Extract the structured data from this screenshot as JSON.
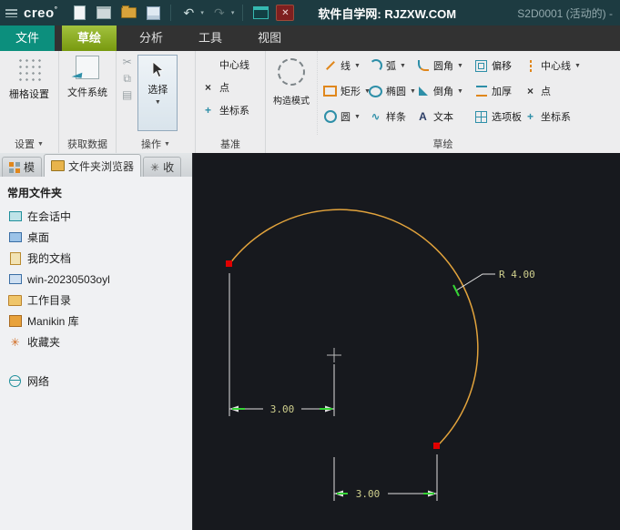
{
  "ui": {
    "dropdown": "▼",
    "small_dropdown": "▾",
    "icons": {
      "undo": "↶",
      "redo": "↷",
      "close": "✕",
      "scissors": "✂",
      "copy": "⧉",
      "paste": "▤",
      "star": "✳",
      "spline": "∿",
      "cross": "×",
      "text": "A",
      "csys": "+"
    }
  },
  "title_bar": {
    "logo": "creo",
    "logo_mark": "°",
    "title": "软件自学网: RJZXW.COM",
    "doc_label": "S2D0001 (活动的) -"
  },
  "menu": {
    "tabs": [
      {
        "label": "文件"
      },
      {
        "label": "草绘"
      },
      {
        "label": "分析"
      },
      {
        "label": "工具"
      },
      {
        "label": "视图"
      }
    ]
  },
  "ribbon": {
    "grid_settings_label": "栅格设置",
    "settings_group": "设置",
    "file_system_label": "文件系统",
    "get_data_group": "获取数据",
    "select_label": "选择",
    "operations_group": "操作",
    "datum": {
      "centerline": "中心线",
      "point": "点",
      "csys": "坐标系",
      "group": "基准"
    },
    "construction_label": "构造模式",
    "sketch_group": "草绘",
    "sketch_buttons": [
      {
        "label": "线",
        "dd": "▼"
      },
      {
        "label": "弧",
        "dd": "▼"
      },
      {
        "label": "圆角",
        "dd": "▼"
      },
      {
        "label": "偏移",
        "dd": ""
      },
      {
        "label": "中心线",
        "dd": "▼"
      },
      {
        "label": "矩形",
        "dd": "▼"
      },
      {
        "label": "椭圆",
        "dd": "▼"
      },
      {
        "label": "倒角",
        "dd": "▼"
      },
      {
        "label": "加厚",
        "dd": ""
      },
      {
        "label": "点",
        "dd": ""
      },
      {
        "label": "圆",
        "dd": "▼"
      },
      {
        "label": "样条",
        "dd": ""
      },
      {
        "label": "文本",
        "dd": ""
      },
      {
        "label": "选项板",
        "dd": ""
      },
      {
        "label": "坐标系",
        "dd": ""
      }
    ]
  },
  "sidebar": {
    "tabs": {
      "model_tree": "模",
      "folder_browser": "文件夹浏览器",
      "favorites": "收"
    },
    "header": "常用文件夹",
    "items": [
      {
        "label": "在会话中"
      },
      {
        "label": "桌面"
      },
      {
        "label": "我的文档"
      },
      {
        "label": "win-20230503oyl"
      },
      {
        "label": "工作目录"
      },
      {
        "label": "Manikin 库"
      },
      {
        "label": "收藏夹"
      },
      {
        "label": "网络"
      }
    ]
  },
  "canvas": {
    "dim_radius": "R 4.00",
    "dim_width": "3.00",
    "dim_bottom": "3.00",
    "colors": {
      "arc": "#e2a33c",
      "dim_text": "#cfcf8d",
      "endpoint": "#e00000",
      "tick": "#35d435",
      "line": "#e0e0e0",
      "background": "#17191e"
    }
  }
}
